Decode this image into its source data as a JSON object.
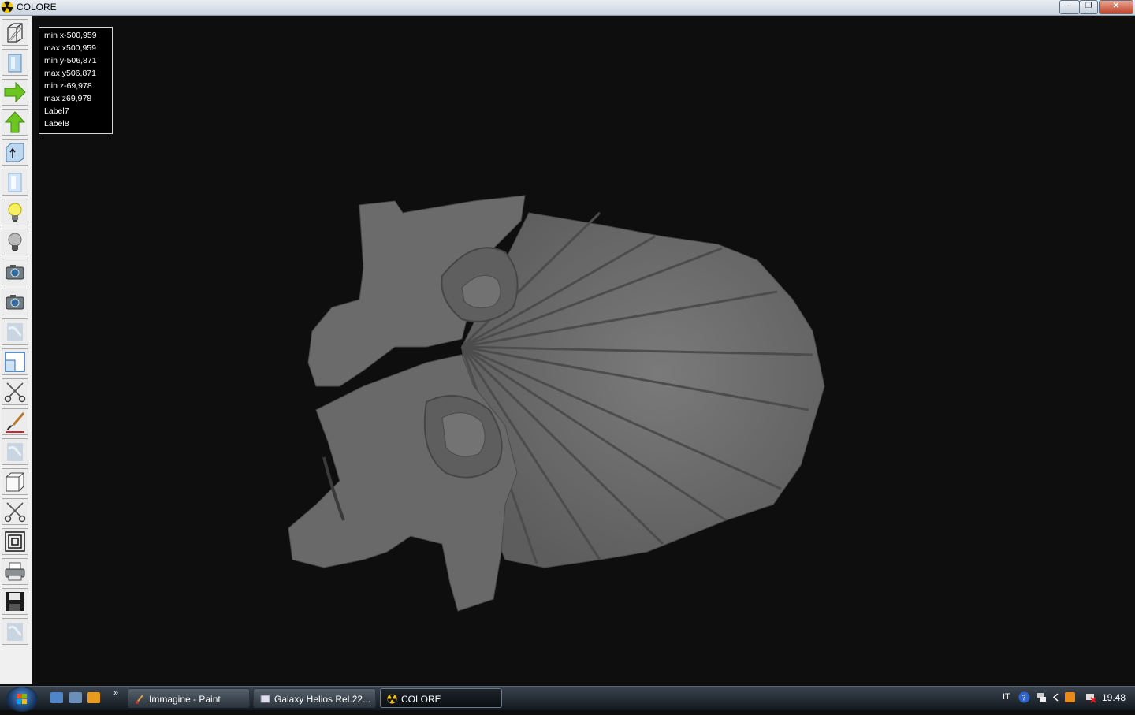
{
  "window": {
    "title": "COLORE",
    "minimize": "–",
    "maximize": "❐",
    "close": "✕"
  },
  "info_panel": {
    "lines": [
      "min x-500,959",
      "max x500,959",
      "min y-506,871",
      "max y506,871",
      "min z-69,978",
      "max z69,978",
      "Label7",
      "Label8"
    ]
  },
  "toolbar": {
    "tools": [
      "wireframe-view",
      "solid-view",
      "rotate-right-arrow",
      "rotate-up-arrow",
      "axis-up",
      "light-box",
      "light-on",
      "light-off",
      "camera-1",
      "camera-2",
      "texture-1",
      "viewport-split",
      "cut-scissors-1",
      "paint-brush",
      "texture-2",
      "cube",
      "cut-scissors-2",
      "contour-lines",
      "printer",
      "save-floppy",
      "texture-3"
    ]
  },
  "taskbar": {
    "quick_launch_more": "»",
    "tasks": [
      "Immagine - Paint",
      "Galaxy Helios  Rel.22...",
      "COLORE"
    ],
    "language": "IT",
    "clock": "19.48"
  },
  "colors": {
    "viewport_bg": "#0e0e0e",
    "model": "#6a6a6a",
    "accent_green": "#5fbf1f"
  }
}
